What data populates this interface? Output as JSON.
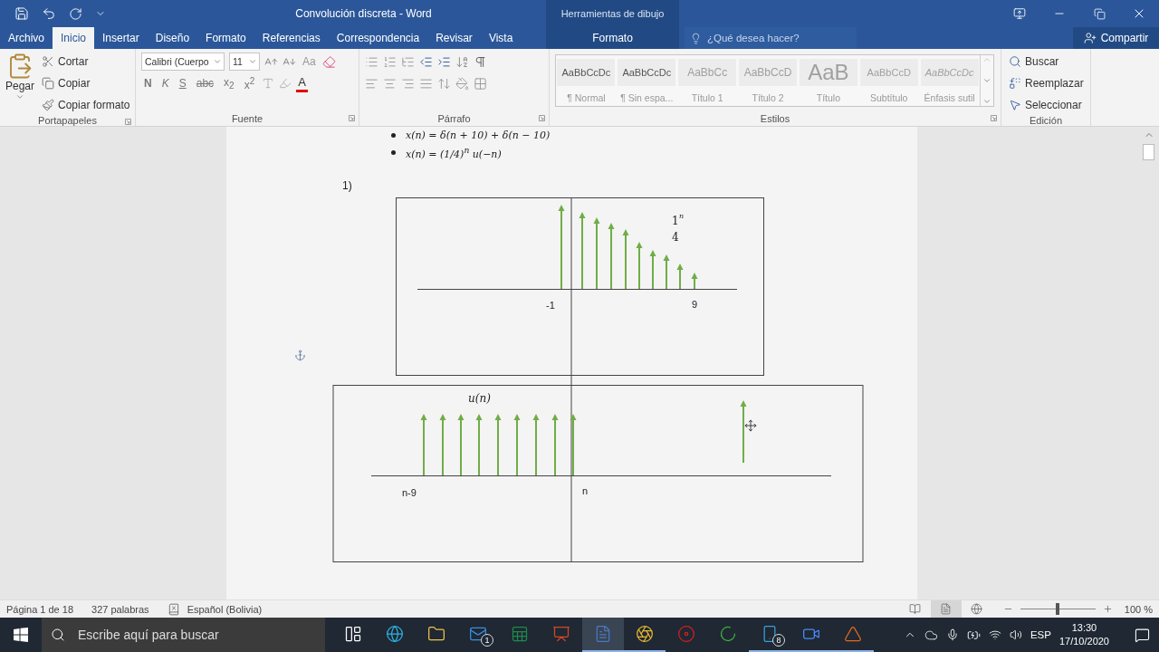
{
  "window": {
    "title": "Convolución discreta - Word",
    "context_group": "Herramientas de dibujo"
  },
  "tabs": [
    {
      "label": "Archivo",
      "selected": false,
      "kind": "file"
    },
    {
      "label": "Inicio",
      "selected": true,
      "kind": "normal"
    },
    {
      "label": "Insertar",
      "selected": false,
      "kind": "normal"
    },
    {
      "label": "Diseño",
      "selected": false,
      "kind": "normal"
    },
    {
      "label": "Formato",
      "selected": false,
      "kind": "normal"
    },
    {
      "label": "Referencias",
      "selected": false,
      "kind": "normal"
    },
    {
      "label": "Correspondencia",
      "selected": false,
      "kind": "normal"
    },
    {
      "label": "Revisar",
      "selected": false,
      "kind": "normal"
    },
    {
      "label": "Vista",
      "selected": false,
      "kind": "normal"
    },
    {
      "label": "Formato",
      "selected": false,
      "kind": "context"
    }
  ],
  "tell_me": {
    "placeholder": "¿Qué desea hacer?"
  },
  "share": {
    "label": "Compartir"
  },
  "clipboard": {
    "group": "Portapapeles",
    "paste": "Pegar",
    "actions": [
      "Cortar",
      "Copiar",
      "Copiar formato"
    ]
  },
  "font": {
    "group": "Fuente",
    "name": "Calibri (Cuerpo",
    "size": "11",
    "case": "Aa",
    "color_button": "A",
    "format_buttons": [
      {
        "label": "N",
        "kind": "bold"
      },
      {
        "label": "K",
        "kind": "italic"
      },
      {
        "label": "S",
        "kind": "underline"
      },
      {
        "label": "abc",
        "kind": "strike"
      },
      {
        "label": "x$_{2}$",
        "kind": "sub"
      },
      {
        "label": "x$^{2}$",
        "kind": "sup"
      }
    ]
  },
  "paragraph": {
    "group": "Párrafo"
  },
  "styles": {
    "group": "Estilos",
    "items": [
      {
        "preview": "AaBbCcDc",
        "name": "¶ Normal",
        "kind": "body"
      },
      {
        "preview": "AaBbCcDc",
        "name": "¶ Sin espa...",
        "kind": "body"
      },
      {
        "preview": "AaBbCc",
        "name": "Título 1",
        "kind": "heading"
      },
      {
        "preview": "AaBbCcD",
        "name": "Título 2",
        "kind": "heading"
      },
      {
        "preview": "AaB",
        "name": "Título",
        "kind": "title"
      },
      {
        "preview": "AaBbCcD",
        "name": "Subtítulo",
        "kind": "subtitle"
      },
      {
        "preview": "AaBbCcDc",
        "name": "Énfasis sutil",
        "kind": "emphasis"
      }
    ]
  },
  "editing": {
    "group": "Edición",
    "actions": [
      "Buscar",
      "Reemplazar",
      "Seleccionar"
    ]
  },
  "document": {
    "equations": [
      "x(n) = δ(n + 10) + δ(n − 10)",
      "x(n) = (1/4)$^{n}$ u(−n)"
    ],
    "item_number": "1)",
    "plot_top": {
      "left_tick": "-1",
      "right_tick": "9",
      "fraction": {
        "numerator": "1",
        "exponent": "n",
        "denominator": "4"
      }
    },
    "plot_bottom": {
      "signal_label": "u(n)",
      "left_tick": "n-9",
      "right_tick": "n"
    }
  },
  "status_bar": {
    "page": "Página 1 de 18",
    "words": "327 palabras",
    "language": "Español (Bolivia)",
    "zoom": "100 %",
    "zoom_slider": {
      "level": 0.5
    },
    "views": [
      {
        "kind": "read",
        "selected": false
      },
      {
        "kind": "print",
        "selected": true
      },
      {
        "kind": "web",
        "selected": false
      }
    ]
  },
  "taskbar": {
    "search": {
      "placeholder": "Escribe aquí para buscar"
    },
    "apps": [
      {
        "kind": "task_view",
        "running": false,
        "selected": false
      },
      {
        "kind": "edge",
        "running": false,
        "selected": false
      },
      {
        "kind": "explorer",
        "running": false,
        "selected": false
      },
      {
        "kind": "mail",
        "running": false,
        "selected": false,
        "badge": "1"
      },
      {
        "kind": "excel",
        "running": false,
        "selected": false
      },
      {
        "kind": "powerpoint",
        "running": false,
        "selected": false
      },
      {
        "kind": "word",
        "running": true,
        "selected": true
      },
      {
        "kind": "chrome",
        "running": true,
        "selected": false
      },
      {
        "kind": "recorder",
        "running": false,
        "selected": false
      },
      {
        "kind": "loader",
        "running": false,
        "selected": false
      },
      {
        "kind": "phone",
        "running": true,
        "selected": false,
        "badge": "8"
      },
      {
        "kind": "zoom",
        "running": true,
        "selected": false
      },
      {
        "kind": "matlab",
        "running": true,
        "selected": false
      }
    ],
    "tray": {
      "language": "ESP",
      "time": "13:30",
      "date": "17/10/2020"
    }
  }
}
